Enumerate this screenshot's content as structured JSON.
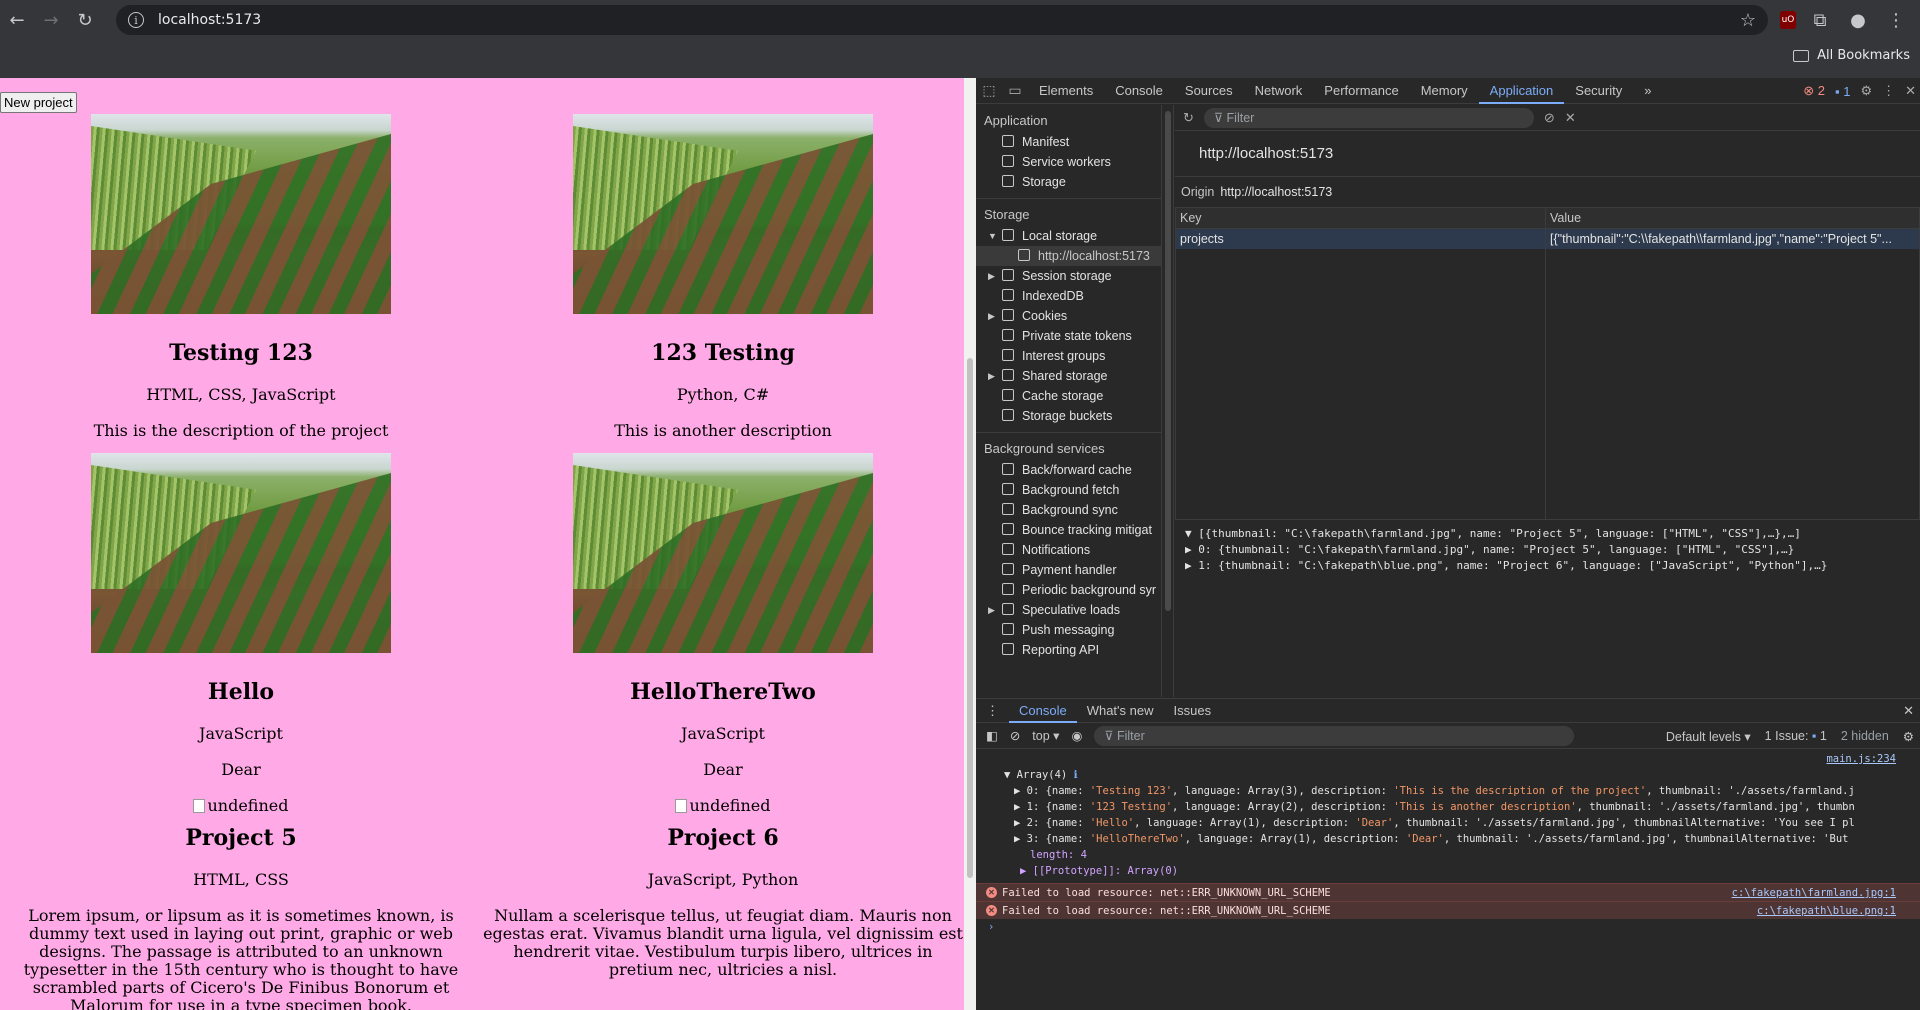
{
  "browser": {
    "url": "localhost:5173",
    "bookmarks_label": "All Bookmarks",
    "ext_label": "uO"
  },
  "page": {
    "new_project_label": "New project",
    "cards": [
      {
        "title": "Testing 123",
        "languages": "HTML, CSS, JavaScript",
        "description": "This is the description of the project",
        "has_image": true
      },
      {
        "title": "123 Testing",
        "languages": "Python, C#",
        "description": "This is another description",
        "has_image": true
      },
      {
        "title": "Hello",
        "languages": "JavaScript",
        "description": "Dear",
        "has_image": true,
        "broken_alt": "undefined"
      },
      {
        "title": "HelloThereTwo",
        "languages": "JavaScript",
        "description": "Dear",
        "has_image": true,
        "broken_alt": "undefined"
      },
      {
        "title": "Project 5",
        "languages": "HTML, CSS",
        "description": "Lorem ipsum, or lipsum as it is sometimes known, is dummy text used in laying out print, graphic or web designs. The passage is attributed to an unknown typesetter in the 15th century who is thought to have scrambled parts of Cicero's De Finibus Bonorum et Malorum for use in a type specimen book."
      },
      {
        "title": "Project 6",
        "languages": "JavaScript, Python",
        "description": "Nullam a scelerisque tellus, ut feugiat diam. Mauris non egestas erat. Vivamus blandit urna ligula, vel dignissim est hendrerit vitae. Vestibulum turpis libero, ultrices in pretium nec, ultricies a nisl."
      }
    ]
  },
  "devtools": {
    "tabs": [
      "Elements",
      "Console",
      "Sources",
      "Network",
      "Performance",
      "Memory",
      "Application",
      "Security"
    ],
    "active_tab": "Application",
    "error_count": "2",
    "info_count": "1",
    "sidebar": {
      "application_label": "Application",
      "application_items": [
        "Manifest",
        "Service workers",
        "Storage"
      ],
      "storage_label": "Storage",
      "storage_items": [
        "Local storage",
        "http://localhost:5173",
        "Session storage",
        "IndexedDB",
        "Cookies",
        "Private state tokens",
        "Interest groups",
        "Shared storage",
        "Cache storage",
        "Storage buckets"
      ],
      "background_label": "Background services",
      "background_items": [
        "Back/forward cache",
        "Background fetch",
        "Background sync",
        "Bounce tracking mitigat",
        "Notifications",
        "Payment handler",
        "Periodic background syr",
        "Speculative loads",
        "Push messaging",
        "Reporting API"
      ]
    },
    "filter_placeholder": "Filter",
    "origin_title": "http://localhost:5173",
    "origin_label": "Origin",
    "origin_value": "http://localhost:5173",
    "table": {
      "key_header": "Key",
      "value_header": "Value",
      "rows": [
        {
          "key": "projects",
          "value": "[{\"thumbnail\":\"C:\\\\fakepath\\\\farmland.jpg\",\"name\":\"Project 5\"..."
        }
      ]
    },
    "preview_lines": [
      "▼ [{thumbnail: \"C:\\fakepath\\farmland.jpg\", name: \"Project 5\", language: [\"HTML\", \"CSS\"],…},…]",
      "  ▶ 0: {thumbnail: \"C:\\fakepath\\farmland.jpg\", name: \"Project 5\", language: [\"HTML\", \"CSS\"],…}",
      "  ▶ 1: {thumbnail: \"C:\\fakepath\\blue.png\", name: \"Project 6\", language: [\"JavaScript\", \"Python\"],…}"
    ],
    "drawer": {
      "tabs": [
        "Console",
        "What's new",
        "Issues"
      ],
      "context": "top",
      "filter_placeholder": "Filter",
      "levels": "Default levels",
      "issues_label": "1 Issue:",
      "issues_count": "1",
      "hidden_label": "2 hidden",
      "source_main": "main.js:234",
      "array_header": "Array(4)",
      "entries": [
        {
          "prefix": "▶ 0: {name: ",
          "name": "'Testing 123'",
          "mid": ", language: Array(3), description: ",
          "desc": "'This is the description of the project'",
          "tail": ", thumbnail: './assets/farmland.j"
        },
        {
          "prefix": "▶ 1: {name: ",
          "name": "'123 Testing'",
          "mid": ", language: Array(2), description: ",
          "desc": "'This is another description'",
          "tail": ", thumbnail: './assets/farmland.jpg', thumbn"
        },
        {
          "prefix": "▶ 2: {name: ",
          "name": "'Hello'",
          "mid": ", language: Array(1), description: ",
          "desc": "'Dear'",
          "tail": ", thumbnail: './assets/farmland.jpg', thumbnailAlternative: 'You see I pl"
        },
        {
          "prefix": "▶ 3: {name: ",
          "name": "'HelloThereTwo'",
          "mid": ", language: Array(1), description: ",
          "desc": "'Dear'",
          "tail": ", thumbnail: './assets/farmland.jpg', thumbnailAlternative: 'But"
        }
      ],
      "length_line": "length: 4",
      "prototype_line": "▶ [[Prototype]]: Array(0)",
      "errors": [
        {
          "text": "Failed to load resource: net::ERR_UNKNOWN_URL_SCHEME",
          "source": "c:\\fakepath\\farmland.jpg:1"
        },
        {
          "text": "Failed to load resource: net::ERR_UNKNOWN_URL_SCHEME",
          "source": "c:\\fakepath\\blue.png:1"
        }
      ]
    }
  }
}
